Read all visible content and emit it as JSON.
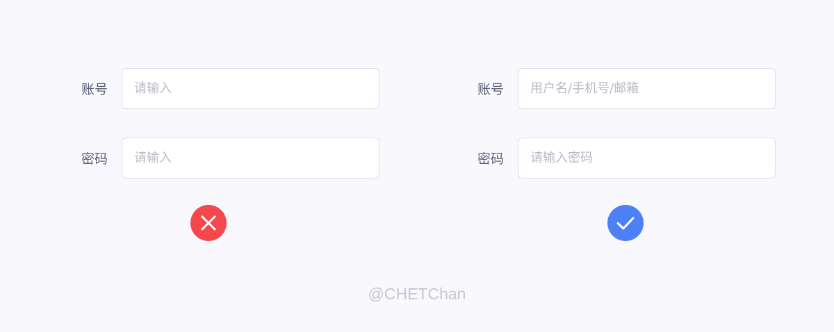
{
  "colors": {
    "background": "#f8f8fd",
    "wrong_badge": "#f5484c",
    "right_badge": "#4b80f7",
    "label_text": "#5b6072",
    "placeholder_text": "#b7bac6",
    "border": "#dcdde6"
  },
  "bad_example": {
    "account_label": "账号",
    "account_placeholder": "请输入",
    "password_label": "密码",
    "password_placeholder": "请输入",
    "verdict_icon": "close-icon"
  },
  "good_example": {
    "account_label": "账号",
    "account_placeholder": "用户名/手机号/邮箱",
    "password_label": "密码",
    "password_placeholder": "请输入密码",
    "verdict_icon": "check-icon"
  },
  "footer": {
    "credit": "@CHETChan"
  }
}
